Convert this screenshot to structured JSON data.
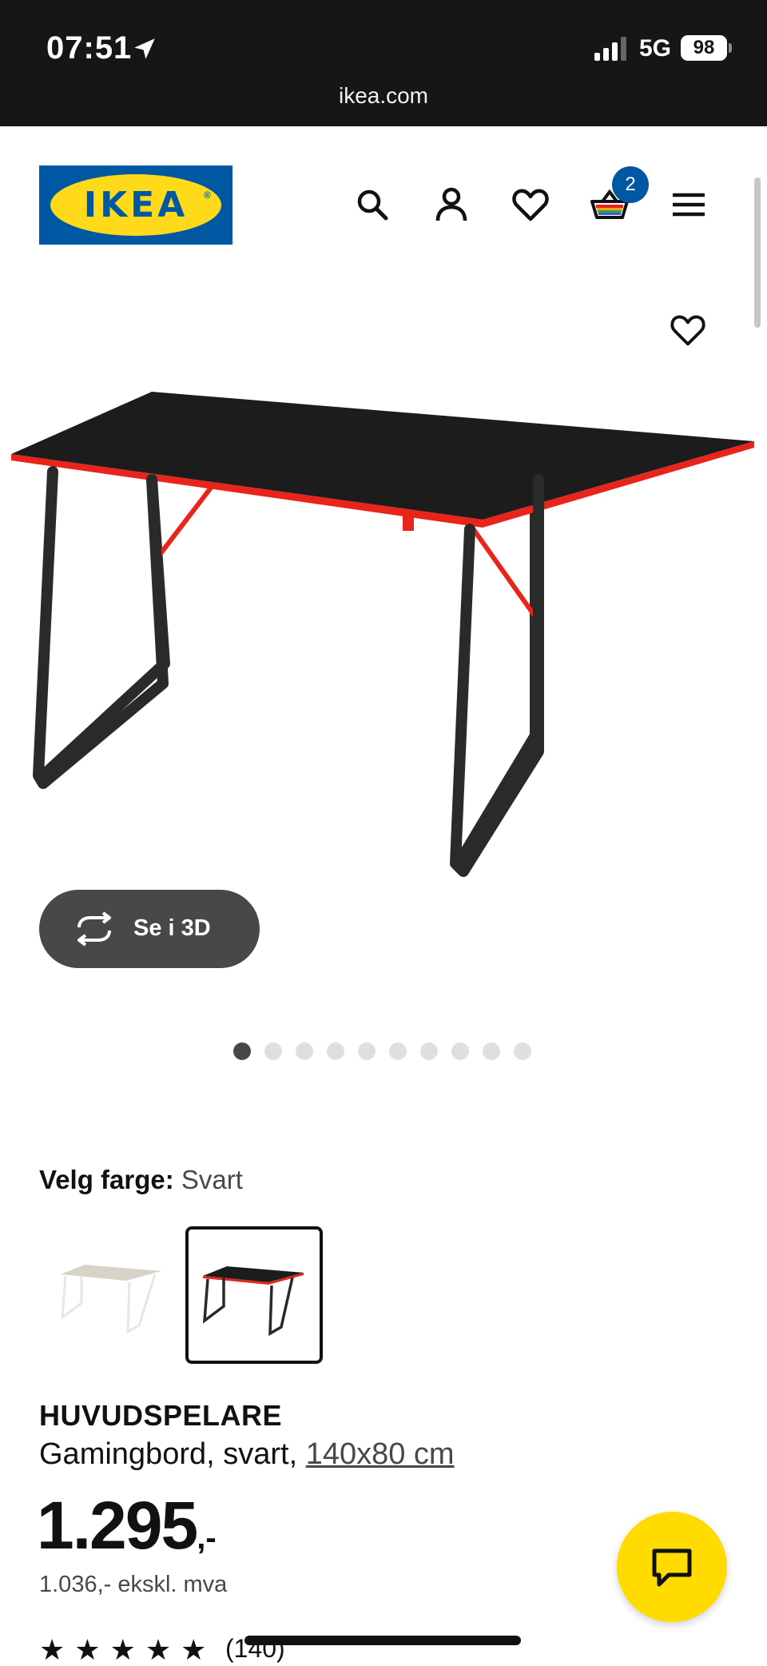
{
  "status_bar": {
    "time": "07:51",
    "network": "5G",
    "battery": "98"
  },
  "browser": {
    "url": "ikea.com"
  },
  "header": {
    "logo_text": "IKEA",
    "logo_reg": "®",
    "cart_count": "2",
    "icons": [
      "search-icon",
      "account-icon",
      "heart-icon",
      "basket-icon",
      "menu-icon"
    ]
  },
  "gallery": {
    "view_3d_label": "Se i 3D",
    "image_count": 10,
    "active_index": 0
  },
  "color_picker": {
    "label": "Velg farge:",
    "selected": "Svart",
    "options": [
      "white-beige",
      "black-red"
    ]
  },
  "product": {
    "name": "HUVUDSPELARE",
    "description": "Gamingbord, svart,",
    "size": "140x80 cm",
    "price": "1.295",
    "price_suffix": ",-",
    "price_ex_vat": "1.036,- ekskl. mva",
    "rating": 5,
    "review_count": "(140)"
  },
  "colors": {
    "ikea_blue": "#0058a3",
    "ikea_yellow": "#ffda1a",
    "chat_yellow": "#ffdb00",
    "desk_red": "#e8241b",
    "desk_black": "#1c1c1c"
  }
}
